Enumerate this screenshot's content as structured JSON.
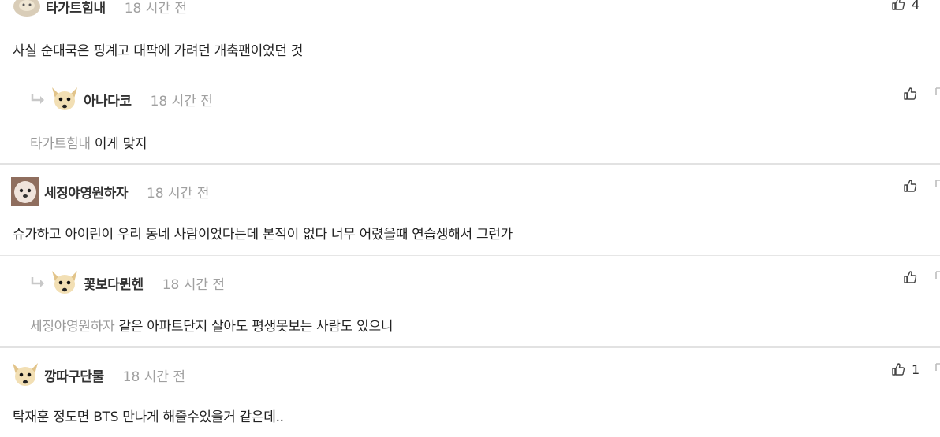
{
  "comments": [
    {
      "nickname": "타가트힘내",
      "time": "18 시간 전",
      "text": "사실 순대국은 핑계고 대팍에 가려던 개축팬이었던 것",
      "like_count": "4",
      "avatar_icon": "profile-avatar-icon"
    },
    {
      "nickname": "아나다코",
      "time": "18 시간 전",
      "mention": "타가트힘내",
      "text": "이게 맞지",
      "avatar_icon": "dog-avatar-icon"
    },
    {
      "nickname": "세징야영원하자",
      "time": "18 시간 전",
      "text": "슈가하고 아이린이 우리 동네 사람이었다는데 본적이 없다 너무 어렸을때 연습생해서 그런가",
      "avatar_icon": "dog-avatar-icon"
    },
    {
      "nickname": "꽃보다뮌헨",
      "time": "18 시간 전",
      "mention": "세징야영원하자",
      "text": "같은 아파트단지 살아도 평생못보는 사람도 있으니",
      "avatar_icon": "dog-avatar-icon"
    },
    {
      "nickname": "깡따구단물",
      "time": "18 시간 전",
      "text": "탁재훈 정도면 BTS 만나게 해줄수있을거 같은데..",
      "like_count": "1",
      "avatar_icon": "dog-avatar-icon"
    }
  ],
  "colors": {
    "nickname": "#333333",
    "time": "#a0a0a0",
    "mention": "#9a9a9a",
    "divider": "#e6e6e6"
  }
}
